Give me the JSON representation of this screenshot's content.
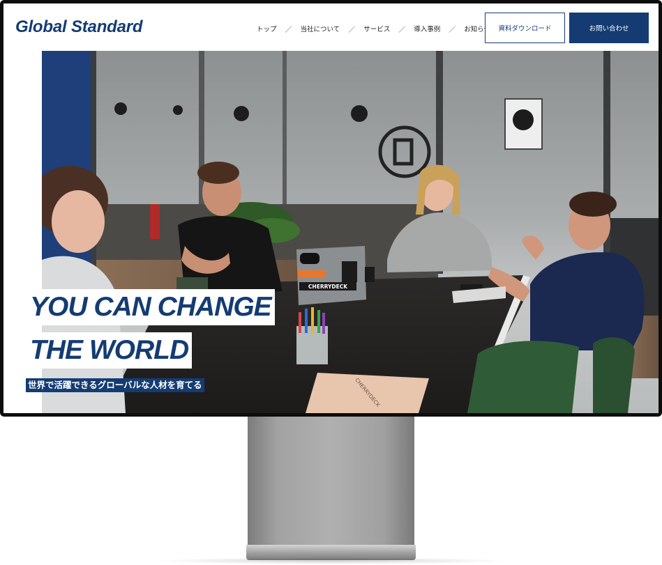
{
  "header": {
    "logo": "Global Standard",
    "nav": [
      {
        "label": "トップ"
      },
      {
        "label": "当社について"
      },
      {
        "label": "サービス"
      },
      {
        "label": "導入事例"
      },
      {
        "label": "お知らせ"
      }
    ],
    "nav_separator": "／",
    "download_button": "資料ダウンロード",
    "contact_button": "お問い合わせ"
  },
  "hero": {
    "headline_line1": "YOU CAN CHANGE",
    "headline_line2": "THE WORLD",
    "subline": "世界で活躍できるグローバルな人材を育てる",
    "laptop_sticker": "CHERRYDECK",
    "laptop_sticker_2": "CHERRYDECK"
  },
  "colors": {
    "brand_navy": "#143c73",
    "white": "#ffffff"
  }
}
